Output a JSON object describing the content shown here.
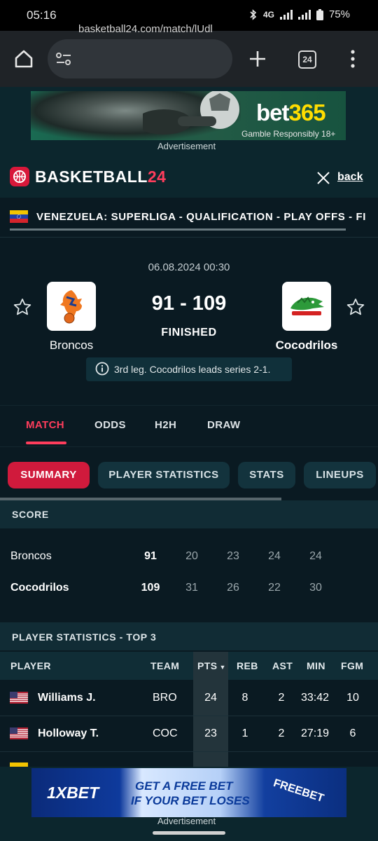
{
  "status_bar": {
    "time": "05:16",
    "network": "4G",
    "battery": "75%"
  },
  "browser": {
    "url": "basketball24.com/match/lUdl",
    "tab_count": "24"
  },
  "ads": {
    "top": {
      "brand_main": "bet",
      "brand_accent": "365",
      "tagline": "Gamble Responsibly 18+",
      "label": "Advertisement"
    },
    "bottom": {
      "brand": "1XBET",
      "headline_1": "GET A FREE BET",
      "headline_2": "IF YOUR BET LOSES",
      "badge": "FREEBET",
      "label": "Advertisement"
    }
  },
  "header": {
    "logo_main": "BASKETBALL",
    "logo_num": "24",
    "back_label": "back"
  },
  "breadcrumb": {
    "text": "VENEZUELA: SUPERLIGA - QUALIFICATION - PLAY OFFS - FINAL"
  },
  "match": {
    "datetime": "06.08.2024 00:30",
    "score": "91 - 109",
    "status": "FINISHED",
    "home": {
      "name": "Broncos"
    },
    "away": {
      "name": "Cocodrilos"
    },
    "info": "3rd leg. Cocodrilos leads series 2-1."
  },
  "tabs": [
    "MATCH",
    "ODDS",
    "H2H",
    "DRAW"
  ],
  "subtabs": [
    "SUMMARY",
    "PLAYER STATISTICS",
    "STATS",
    "LINEUPS"
  ],
  "score_section": {
    "title": "SCORE",
    "rows": [
      {
        "team": "Broncos",
        "total": "91",
        "q": [
          "20",
          "23",
          "24",
          "24"
        ]
      },
      {
        "team": "Cocodrilos",
        "total": "109",
        "q": [
          "31",
          "26",
          "22",
          "30"
        ]
      }
    ]
  },
  "player_stats": {
    "title": "PLAYER STATISTICS - TOP 3",
    "columns": [
      "PLAYER",
      "TEAM",
      "PTS",
      "REB",
      "AST",
      "MIN",
      "FGM"
    ],
    "rows": [
      {
        "player": "Williams J.",
        "team": "BRO",
        "pts": "24",
        "reb": "8",
        "ast": "2",
        "min": "33:42",
        "fgm": "10"
      },
      {
        "player": "Holloway T.",
        "team": "COC",
        "pts": "23",
        "reb": "1",
        "ast": "2",
        "min": "27:19",
        "fgm": "6"
      }
    ]
  }
}
